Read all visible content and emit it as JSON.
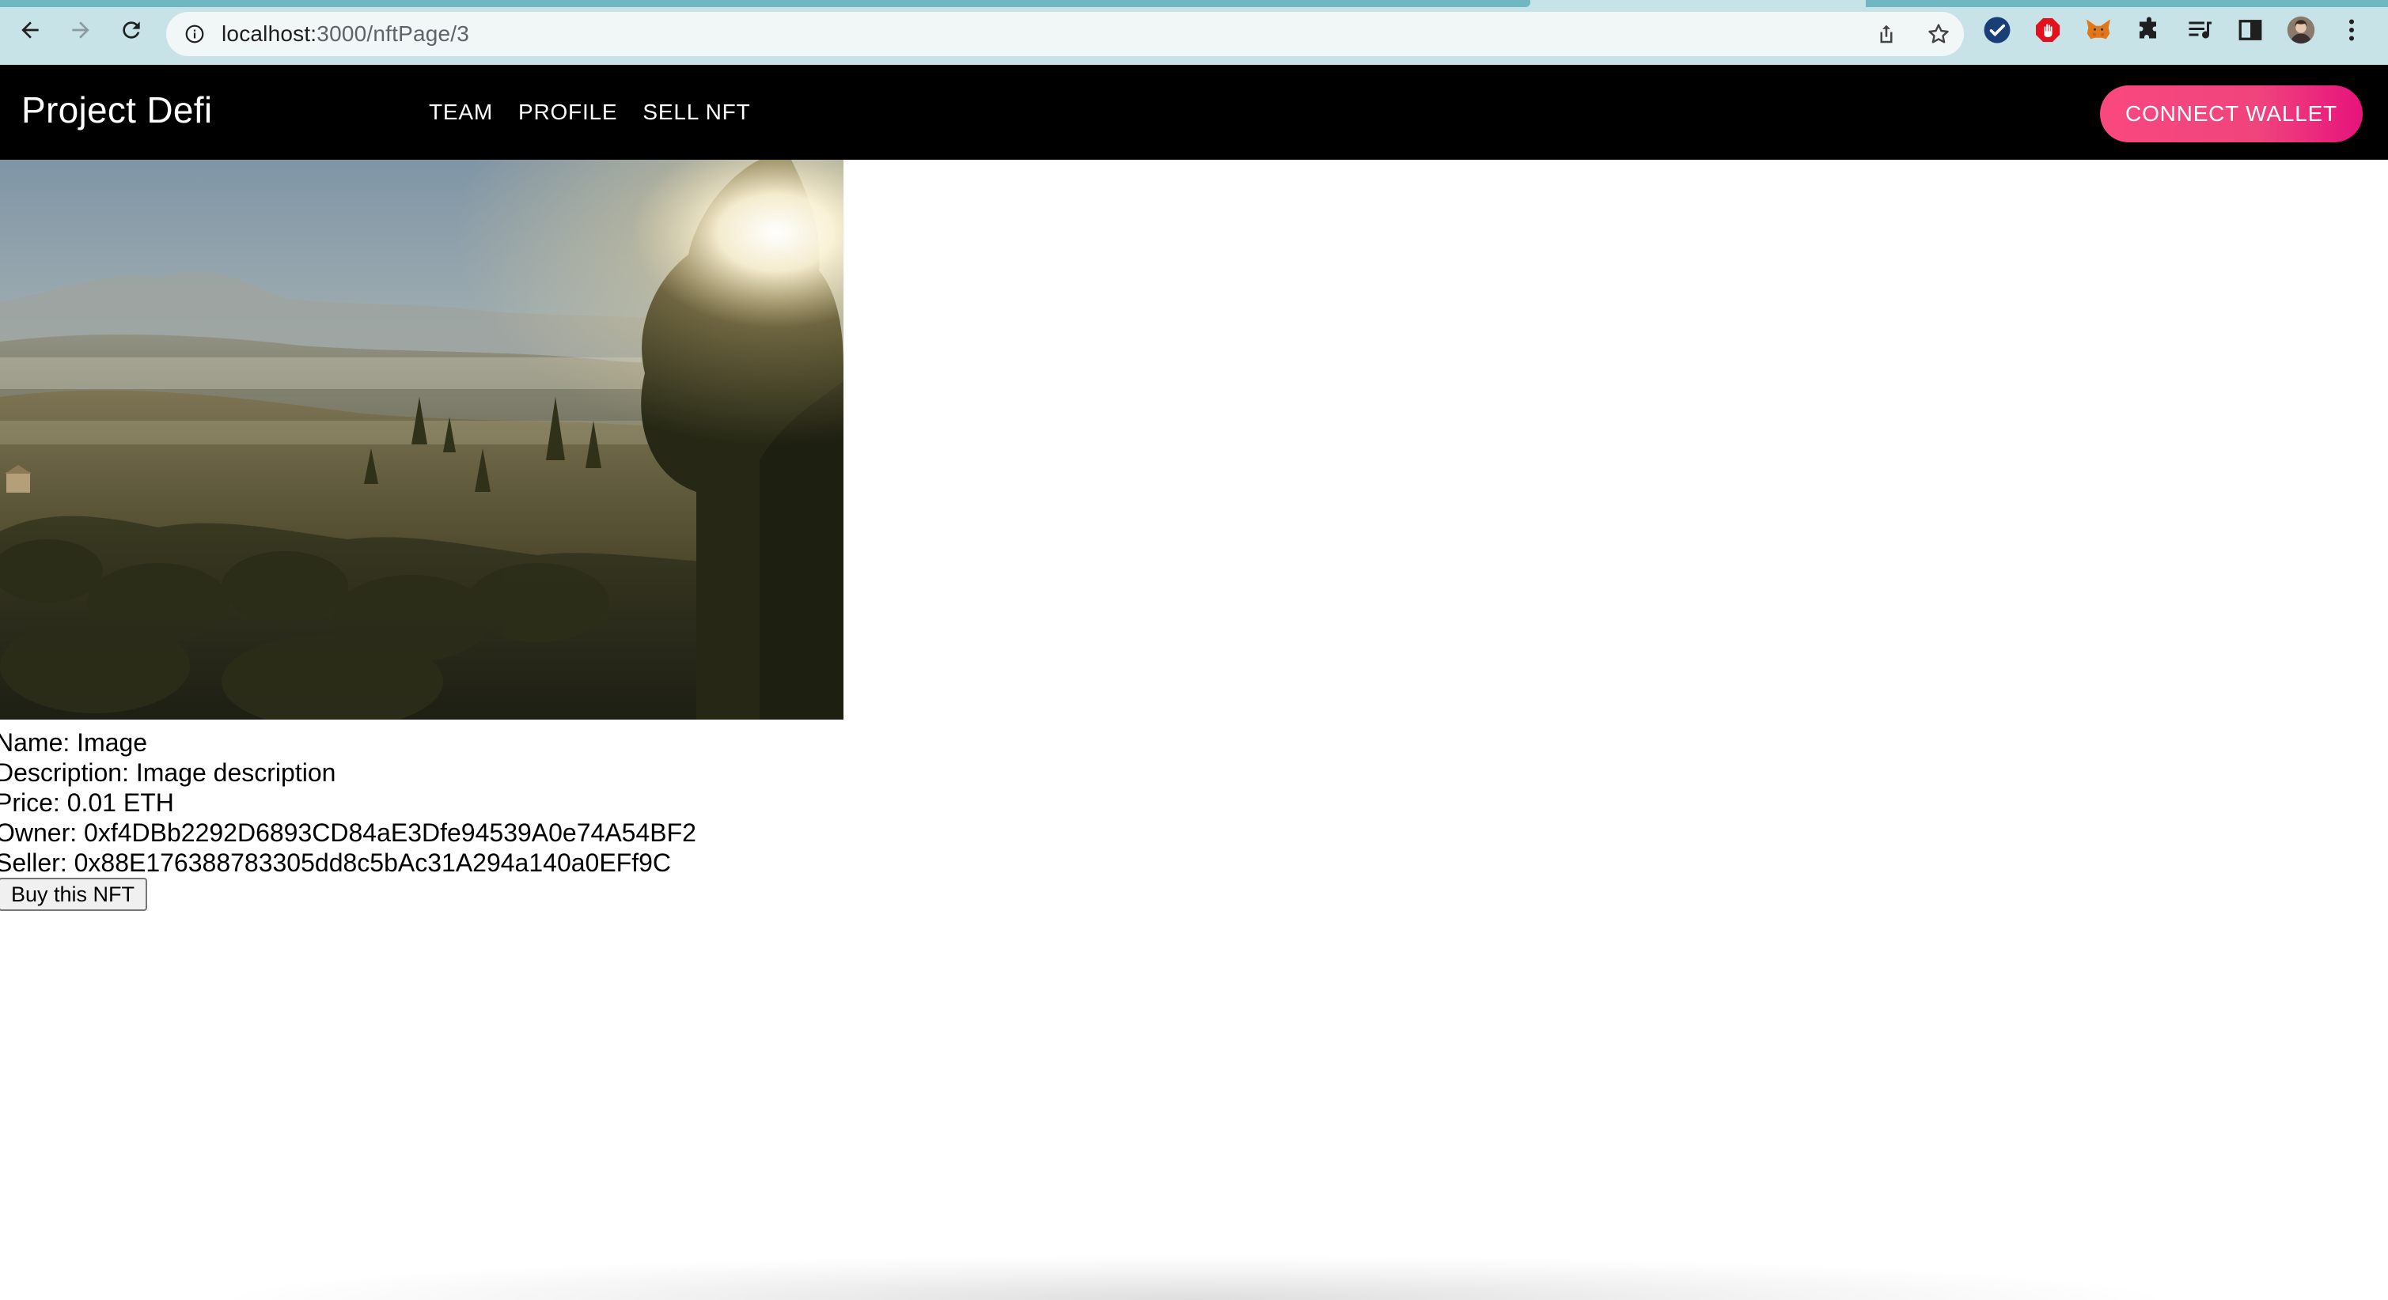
{
  "browser": {
    "url_host": "localhost:",
    "url_rest": "3000/nftPage/3"
  },
  "header": {
    "brand": "Project Defi",
    "nav": [
      {
        "label": "TEAM"
      },
      {
        "label": "PROFILE"
      },
      {
        "label": "SELL NFT"
      }
    ],
    "connect_label": "CONNECT WALLET",
    "accent_start": "#f9487e",
    "accent_end": "#e6137b"
  },
  "nft": {
    "image_alt": "landscape-photo",
    "name_line": "Name: Image",
    "description_line": "Description: Image description",
    "price_line": "Price: 0.01 ETH",
    "owner_line": "Owner: 0xf4DBb2292D6893CD84aE3Dfe94539A0e74A54BF2",
    "seller_line": "Seller: 0x88E176388783305dd8c5bAc31A294a140a0EFf9C",
    "buy_label": "Buy this NFT"
  }
}
